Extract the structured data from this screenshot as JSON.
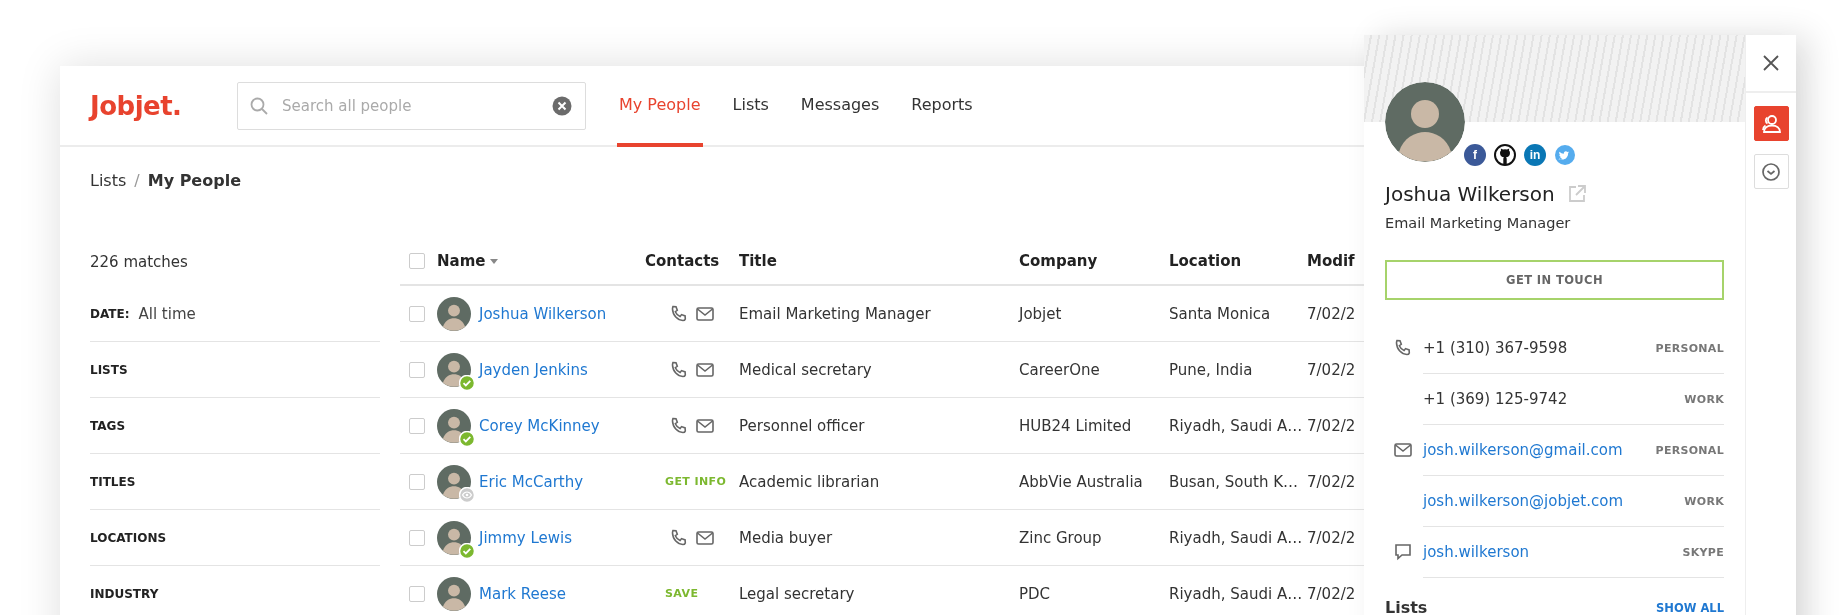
{
  "logo": "Jobjet.",
  "search": {
    "placeholder": "Search all people"
  },
  "tabs": [
    {
      "label": "My People",
      "selected": true
    },
    {
      "label": "Lists",
      "selected": false
    },
    {
      "label": "Messages",
      "selected": false
    },
    {
      "label": "Reports",
      "selected": false
    }
  ],
  "breadcrumb": {
    "separator": "/",
    "items": [
      {
        "label": "Lists",
        "current": false
      },
      {
        "label": "My People",
        "current": true
      }
    ]
  },
  "filters": {
    "matches": "226 matches",
    "items": [
      {
        "label": "DATE:",
        "value": "All time"
      },
      {
        "label": "LISTS"
      },
      {
        "label": "TAGS"
      },
      {
        "label": "TITLES"
      },
      {
        "label": "LOCATIONS"
      },
      {
        "label": "INDUSTRY"
      }
    ]
  },
  "table": {
    "select_all": {
      "checked": false
    },
    "columns": [
      {
        "label": "Name",
        "sorted": true
      },
      {
        "label": "Contacts",
        "sorted": false
      },
      {
        "label": "Title",
        "sorted": false
      },
      {
        "label": "Company",
        "sorted": false
      },
      {
        "label": "Location",
        "sorted": false
      },
      {
        "label": "Modif",
        "sorted": false
      }
    ],
    "rows": [
      {
        "selected": false,
        "name": "Joshua Wilkerson",
        "verified": false,
        "viewed": false,
        "contacts": {
          "kind": "icons"
        },
        "title": "Email Marketing Manager",
        "company": "Jobjet",
        "location": "Santa Monica",
        "modified": "7/02/2"
      },
      {
        "selected": false,
        "name": "Jayden Jenkins",
        "verified": true,
        "viewed": false,
        "contacts": {
          "kind": "icons"
        },
        "title": "Medical secretary",
        "company": "CareerOne",
        "location": "Pune, India",
        "modified": "7/02/2"
      },
      {
        "selected": false,
        "name": "Corey McKinney",
        "verified": true,
        "viewed": false,
        "contacts": {
          "kind": "icons"
        },
        "title": "Personnel officer",
        "company": "HUB24 Limited",
        "location": "Riyadh, Saudi A…",
        "modified": "7/02/2"
      },
      {
        "selected": false,
        "name": "Eric McCarthy",
        "verified": false,
        "viewed": true,
        "contacts": {
          "kind": "action",
          "label": "GET INFO"
        },
        "title": "Academic librarian",
        "company": "AbbVie Australia",
        "location": "Busan, South K…",
        "modified": "7/02/2"
      },
      {
        "selected": false,
        "name": "Jimmy Lewis",
        "verified": true,
        "viewed": false,
        "contacts": {
          "kind": "icons"
        },
        "title": "Media buyer",
        "company": "Zinc Group",
        "location": "Riyadh, Saudi A…",
        "modified": "7/02/2"
      },
      {
        "selected": false,
        "name": "Mark Reese",
        "verified": false,
        "viewed": false,
        "contacts": {
          "kind": "action",
          "label": "SAVE"
        },
        "title": "Legal secretary",
        "company": "PDC",
        "location": "Riyadh, Saudi A…",
        "modified": "7/02/2"
      }
    ]
  },
  "panel": {
    "name": "Joshua Wilkerson",
    "title": "Email Marketing Manager",
    "button": "GET IN TOUCH",
    "socials": [
      {
        "kind": "facebook",
        "glyph": "f"
      },
      {
        "kind": "github"
      },
      {
        "kind": "linkedin",
        "glyph": "in"
      },
      {
        "kind": "twitter"
      }
    ],
    "contacts": [
      {
        "kind": "phone",
        "entries": [
          {
            "value": "+1 (310) 367-9598",
            "type": "PERSONAL"
          },
          {
            "value": "+1 (369) 125-9742",
            "type": "WORK"
          }
        ]
      },
      {
        "kind": "email",
        "entries": [
          {
            "value": "josh.wilkerson@gmail.com",
            "type": "PERSONAL"
          },
          {
            "value": "josh.wilkerson@jobjet.com",
            "type": "WORK"
          }
        ]
      },
      {
        "kind": "skype",
        "entries": [
          {
            "value": "josh.wilkerson",
            "type": "SKYPE"
          }
        ]
      }
    ],
    "lists": {
      "title": "Lists",
      "action": "SHOW ALL"
    },
    "side_tools": [
      {
        "kind": "people",
        "selected": true
      },
      {
        "kind": "clock",
        "selected": false
      }
    ]
  }
}
